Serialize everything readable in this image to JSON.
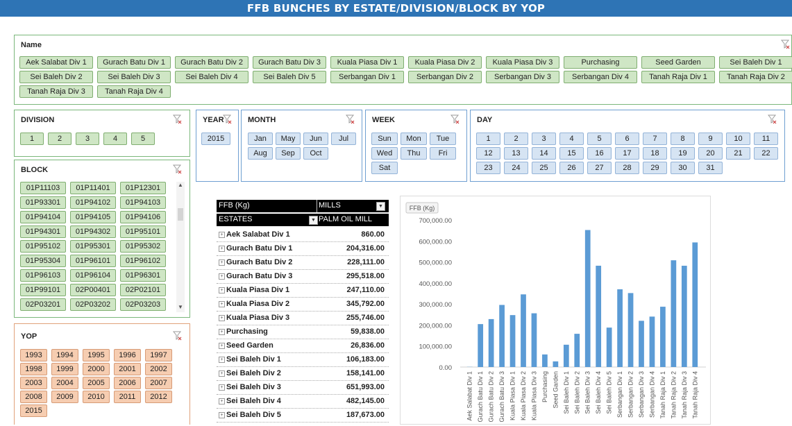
{
  "title": "FFB BUNCHES BY ESTATE/DIVISION/BLOCK BY YOP",
  "name_slicer": {
    "header": "Name",
    "items": [
      "Aek Salabat Div 1",
      "Gurach Batu Div 1",
      "Gurach Batu Div 2",
      "Gurach Batu Div 3",
      "Kuala Piasa Div 1",
      "Kuala Piasa Div 2",
      "Kuala Piasa Div 3",
      "Purchasing",
      "Seed Garden",
      "Sei Baleh Div 1",
      "Sei Baleh Div 2",
      "Sei Baleh Div 3",
      "Sei Baleh Div 4",
      "Sei Baleh Div 5",
      "Serbangan Div 1",
      "Serbangan Div 2",
      "Serbangan Div 3",
      "Serbangan Div 4",
      "Tanah Raja Div 1",
      "Tanah Raja Div 2",
      "Tanah Raja Div 3",
      "Tanah Raja Div 4"
    ]
  },
  "division_slicer": {
    "header": "DIVISION",
    "items": [
      "1",
      "2",
      "3",
      "4",
      "5"
    ]
  },
  "year_slicer": {
    "header": "YEAR",
    "items": [
      "2015"
    ]
  },
  "month_slicer": {
    "header": "MONTH",
    "items": [
      "Jan",
      "May",
      "Jun",
      "Jul",
      "Aug",
      "Sep",
      "Oct"
    ]
  },
  "week_slicer": {
    "header": "WEEK",
    "items": [
      "Sun",
      "Mon",
      "Tue",
      "Wed",
      "Thu",
      "Fri",
      "Sat"
    ]
  },
  "day_slicer": {
    "header": "DAY",
    "items": [
      "1",
      "2",
      "3",
      "4",
      "5",
      "6",
      "7",
      "8",
      "9",
      "10",
      "11",
      "12",
      "13",
      "14",
      "15",
      "16",
      "17",
      "18",
      "19",
      "20",
      "21",
      "22",
      "23",
      "24",
      "25",
      "26",
      "27",
      "28",
      "29",
      "30",
      "31"
    ]
  },
  "block_slicer": {
    "header": "BLOCK",
    "items": [
      "01P11103",
      "01P11401",
      "01P12301",
      "01P93301",
      "01P94102",
      "01P94103",
      "01P94104",
      "01P94105",
      "01P94106",
      "01P94301",
      "01P94302",
      "01P95101",
      "01P95102",
      "01P95301",
      "01P95302",
      "01P95304",
      "01P96101",
      "01P96102",
      "01P96103",
      "01P96104",
      "01P96301",
      "01P99101",
      "02P00401",
      "02P02101",
      "02P03201",
      "02P03202",
      "02P03203"
    ]
  },
  "yop_slicer": {
    "header": "YOP",
    "items": [
      "1993",
      "1994",
      "1995",
      "1996",
      "1997",
      "1998",
      "1999",
      "2000",
      "2001",
      "2002",
      "2003",
      "2004",
      "2005",
      "2006",
      "2007",
      "2008",
      "2009",
      "2010",
      "2011",
      "2012",
      "2015"
    ]
  },
  "pivot": {
    "value_header": "FFB (Kg)",
    "column_field": "MILLS",
    "row_field": "ESTATES",
    "column_item": "PALM OIL MILL",
    "rows": [
      {
        "name": "Aek Salabat Div 1",
        "value": "860.00"
      },
      {
        "name": "Gurach Batu Div 1",
        "value": "204,316.00"
      },
      {
        "name": "Gurach Batu Div 2",
        "value": "228,111.00"
      },
      {
        "name": "Gurach Batu Div 3",
        "value": "295,518.00"
      },
      {
        "name": "Kuala Piasa Div 1",
        "value": "247,110.00"
      },
      {
        "name": "Kuala Piasa Div 2",
        "value": "345,792.00"
      },
      {
        "name": "Kuala Piasa Div 3",
        "value": "255,746.00"
      },
      {
        "name": "Purchasing",
        "value": "59,838.00"
      },
      {
        "name": "Seed Garden",
        "value": "26,836.00"
      },
      {
        "name": "Sei Baleh Div 1",
        "value": "106,183.00"
      },
      {
        "name": "Sei Baleh Div 2",
        "value": "158,141.00"
      },
      {
        "name": "Sei Baleh Div 3",
        "value": "651,993.00"
      },
      {
        "name": "Sei Baleh Div 4",
        "value": "482,145.00"
      },
      {
        "name": "Sei Baleh Div 5",
        "value": "187,673.00"
      }
    ]
  },
  "chart_data": {
    "type": "bar",
    "field_button": "FFB (Kg)",
    "color": "#5b9bd5",
    "categories": [
      "Aek Salabat Div 1",
      "Gurach Batu Div 1",
      "Gurach Batu Div 2",
      "Gurach Batu Div 3",
      "Kuala Piasa Div 1",
      "Kuala Piasa Div 2",
      "Kuala Piasa Div 3",
      "Purchasing",
      "Seed Garden",
      "Sei Baleh Div 1",
      "Sei Baleh Div 2",
      "Sei Baleh Div 3",
      "Sei Baleh Div 4",
      "Sei Baleh Div 5",
      "Serbangan Div 1",
      "Serbangan Div 2",
      "Serbangan Div 3",
      "Serbangan Div 4",
      "Tanah Raja Div 1",
      "Tanah Raja Div 2",
      "Tanah Raja Div 3",
      "Tanah Raja Div 4"
    ],
    "values": [
      860,
      204316,
      228111,
      295518,
      247110,
      345792,
      255746,
      59838,
      26836,
      106183,
      158141,
      651993,
      482145,
      187673,
      370000,
      352000,
      220000,
      240000,
      287000,
      508000,
      482000,
      593000
    ],
    "ylim": [
      0,
      700000
    ],
    "yticks": [
      "0.00",
      "100,000.00",
      "200,000.00",
      "300,000.00",
      "400,000.00",
      "500,000.00",
      "600,000.00",
      "700,000.00"
    ],
    "grid": false
  }
}
